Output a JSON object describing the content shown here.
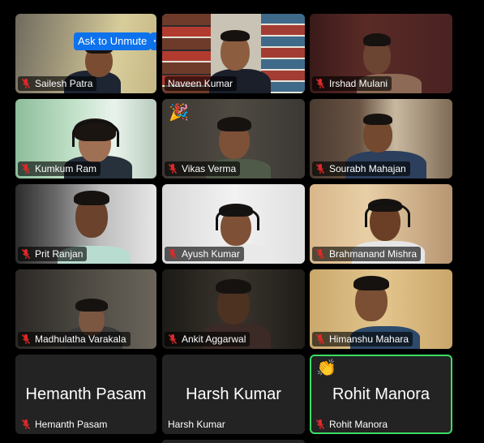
{
  "meeting": {
    "controls": {
      "ask_to_unmute_label": "Ask to Unmute",
      "more_options_label": "···"
    },
    "participants": [
      {
        "name": "Sailesh Patra",
        "muted": true,
        "video": true
      },
      {
        "name": "Naveen Kumar",
        "muted": false,
        "video": true
      },
      {
        "name": "Irshad Mulani",
        "muted": true,
        "video": true
      },
      {
        "name": "Kumkum Ram",
        "muted": true,
        "video": true
      },
      {
        "name": "Vikas Verma",
        "muted": true,
        "video": true,
        "reaction": "🎉"
      },
      {
        "name": "Sourabh Mahajan",
        "muted": true,
        "video": true
      },
      {
        "name": "Prit Ranjan",
        "muted": true,
        "video": true
      },
      {
        "name": "Ayush Kumar",
        "muted": true,
        "video": true
      },
      {
        "name": "Brahmanand Mishra",
        "muted": true,
        "video": true
      },
      {
        "name": "Madhulatha Varakala",
        "muted": true,
        "video": true
      },
      {
        "name": "Ankit Aggarwal",
        "muted": true,
        "video": true
      },
      {
        "name": "Himanshu Mahara",
        "muted": true,
        "video": true
      },
      {
        "name": "Hemanth Pasam",
        "display_name": "Hemanth Pasam",
        "muted": true,
        "video": false
      },
      {
        "name": "Harsh Kumar",
        "display_name": "Harsh Kumar",
        "muted": false,
        "video": false
      },
      {
        "name": "Rohit Manora",
        "display_name": "Rohit Manora",
        "muted": true,
        "video": false,
        "active_speaker": true,
        "reaction": "👏"
      }
    ]
  },
  "colors": {
    "unmute_button": "#0e72ed",
    "active_speaker_border": "#3ddc64",
    "muted_icon": "#e02828"
  },
  "icons": {
    "muted": "mic-muted-icon"
  }
}
